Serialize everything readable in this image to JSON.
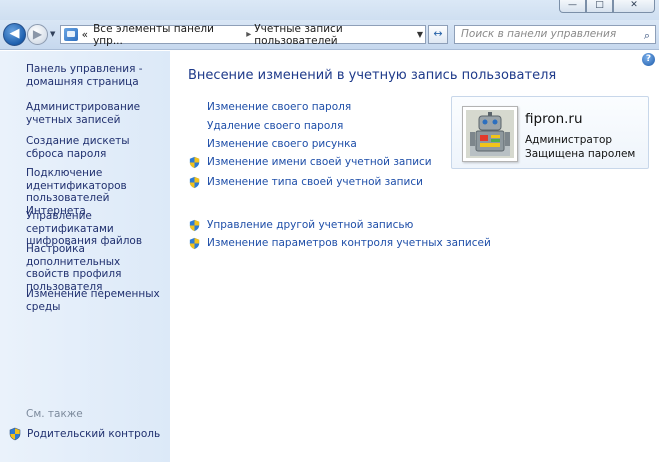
{
  "titlebar": {
    "minimize_glyph": "—",
    "maximize_glyph": "□",
    "close_glyph": "✕"
  },
  "navbar": {
    "back_glyph": "◀",
    "forward_glyph": "▶",
    "breadcrumb_overflow": "«",
    "breadcrumb": [
      "Все элементы панели упр...",
      "Учетные записи пользователей"
    ],
    "refresh_glyph": "↔",
    "search_placeholder": "Поиск в панели управления"
  },
  "sidebar": {
    "items": [
      "Панель управления - домашняя страница",
      "Администрирование учетных записей",
      "Создание дискеты сброса пароля",
      "Подключение идентификаторов пользователей Интернета",
      "Управление сертификатами шифрования файлов",
      "Настройка дополнительных свойств профиля пользователя",
      "Изменение переменных среды"
    ],
    "see_also_heading": "См. также",
    "see_also_items": [
      "Родительский контроль"
    ]
  },
  "main": {
    "help_glyph": "?",
    "title": "Внесение изменений в учетную запись пользователя",
    "tasks": [
      {
        "label": "Изменение своего пароля",
        "shield": false
      },
      {
        "label": "Удаление своего пароля",
        "shield": false
      },
      {
        "label": "Изменение своего рисунка",
        "shield": false
      },
      {
        "label": "Изменение имени своей учетной записи",
        "shield": true
      },
      {
        "label": "Изменение типа своей учетной записи",
        "shield": true
      }
    ],
    "other_tasks": [
      {
        "label": "Управление другой учетной записью",
        "shield": true
      },
      {
        "label": "Изменение параметров контроля учетных записей",
        "shield": true
      }
    ]
  },
  "user": {
    "name": "fipron.ru",
    "role": "Администратор",
    "status": "Защищена паролем"
  },
  "colors": {
    "link": "#1e4ea8",
    "sidebar_bg": "#dce9f8",
    "title": "#1e3a8a"
  }
}
